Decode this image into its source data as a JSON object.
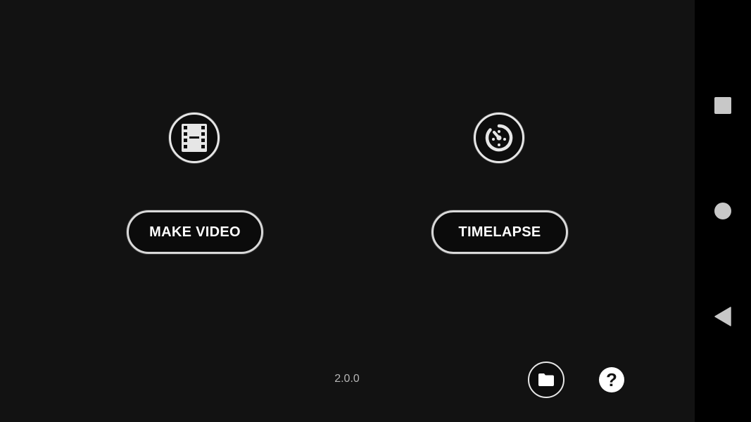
{
  "main": {
    "make_video": {
      "icon": "film-icon",
      "label": "MAKE VIDEO"
    },
    "timelapse": {
      "icon": "timer-icon",
      "label": "TIMELAPSE"
    },
    "version": "2.0.0",
    "folder_icon": "folder-icon",
    "help_icon": "help-icon",
    "help_glyph": "?"
  },
  "navbar": {
    "items": [
      {
        "icon": "recents-square-icon"
      },
      {
        "icon": "home-circle-icon"
      },
      {
        "icon": "back-triangle-icon"
      }
    ]
  },
  "colors": {
    "background": "#121212",
    "navbar": "#000000",
    "accent": "#ffffff",
    "version_text": "#b5b5b5"
  }
}
